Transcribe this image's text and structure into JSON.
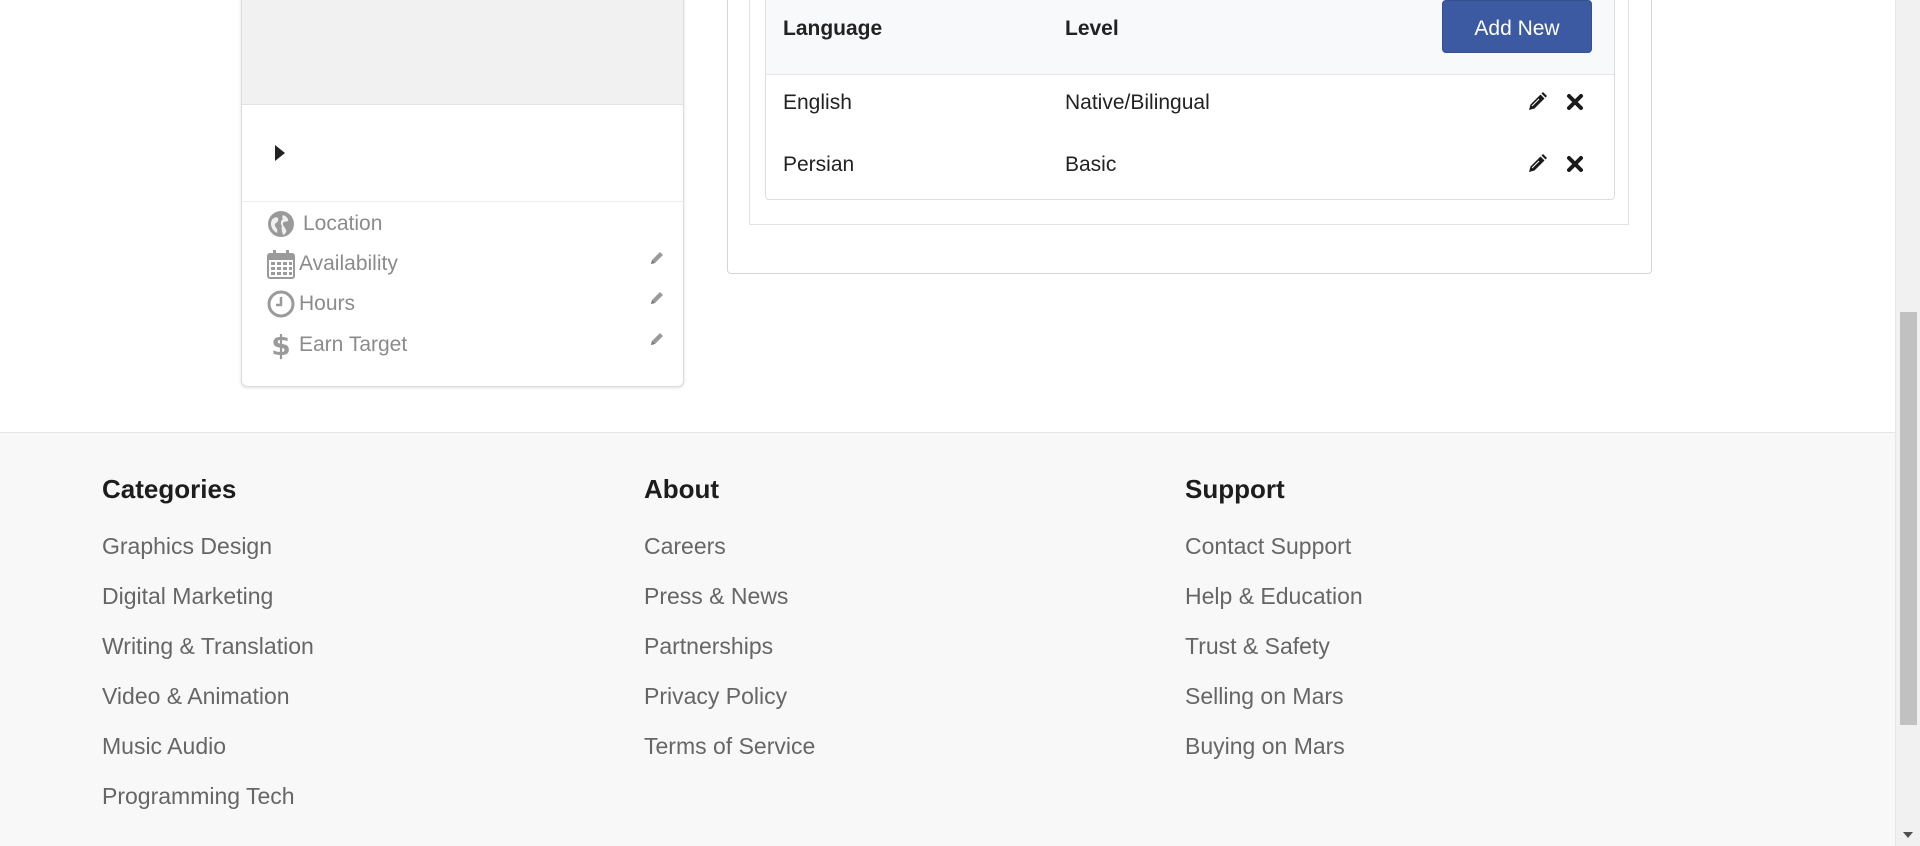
{
  "profile_card": {
    "info": [
      {
        "icon": "globe-icon",
        "label": "Location",
        "editable": false
      },
      {
        "icon": "calendar-icon",
        "label": "Availability",
        "editable": true
      },
      {
        "icon": "clock-icon",
        "label": "Hours",
        "editable": true
      },
      {
        "icon": "dollar-icon",
        "label": "Earn Target",
        "editable": true
      }
    ]
  },
  "languages": {
    "headers": {
      "language": "Language",
      "level": "Level"
    },
    "add_button": "Add New",
    "rows": [
      {
        "language": "English",
        "level": "Native/Bilingual"
      },
      {
        "language": "Persian",
        "level": "Basic"
      }
    ],
    "accent_color": "#3b5aa1"
  },
  "footer": {
    "categories": {
      "title": "Categories",
      "links": [
        "Graphics Design",
        "Digital Marketing",
        "Writing & Translation",
        "Video & Animation",
        "Music Audio",
        "Programming Tech"
      ]
    },
    "about": {
      "title": "About",
      "links": [
        "Careers",
        "Press & News",
        "Partnerships",
        "Privacy Policy",
        "Terms of Service"
      ]
    },
    "support": {
      "title": "Support",
      "links": [
        "Contact Support",
        "Help & Education",
        "Trust & Safety",
        "Selling on Mars",
        "Buying on Mars"
      ]
    }
  }
}
